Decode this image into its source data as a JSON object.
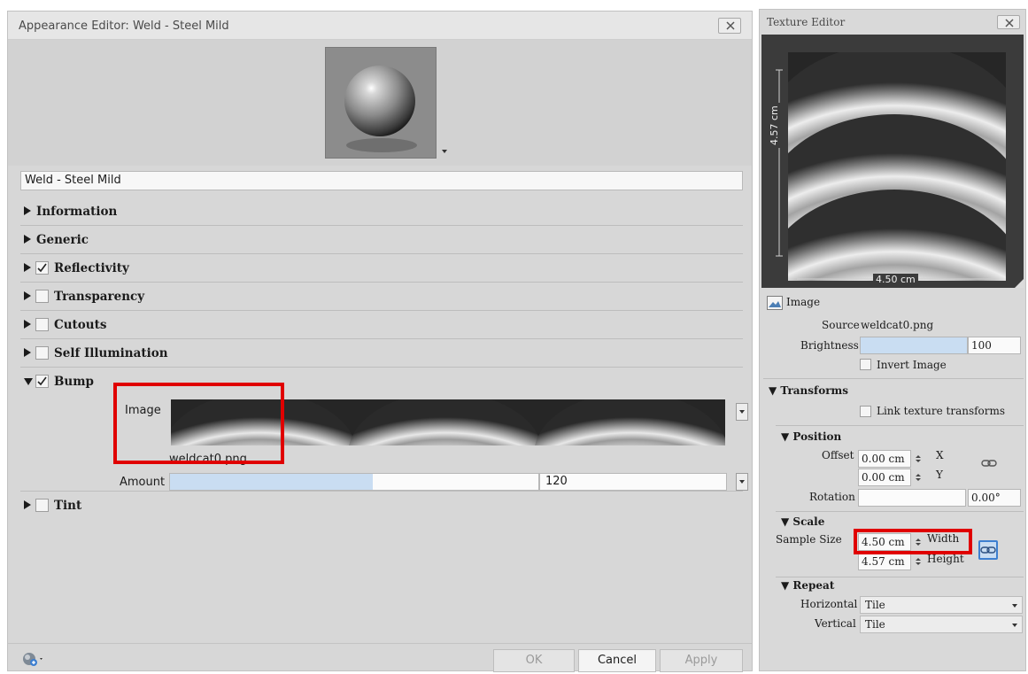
{
  "appearance_editor": {
    "title": "Appearance Editor: Weld - Steel Mild",
    "material_name": "Weld - Steel Mild",
    "sections": {
      "information": "Information",
      "generic": "Generic",
      "reflectivity": "Reflectivity",
      "transparency": "Transparency",
      "cutouts": "Cutouts",
      "self_illumination": "Self Illumination",
      "bump": "Bump",
      "tint": "Tint"
    },
    "bump": {
      "image_label": "Image",
      "image_file": "weldcat0.png",
      "amount_label": "Amount",
      "amount_value": "120",
      "amount_fraction": 0.55
    },
    "buttons": {
      "ok": "OK",
      "cancel": "Cancel",
      "apply": "Apply"
    }
  },
  "texture_editor": {
    "title": "Texture Editor",
    "preview_height_label": "4.57 cm",
    "preview_width_label": "4.50 cm",
    "image_header": "Image",
    "source_label": "Source",
    "source_value": "weldcat0.png",
    "brightness_label": "Brightness",
    "brightness_value": "100",
    "brightness_fraction": 1.0,
    "invert_label": "Invert Image",
    "transforms_header": "Transforms",
    "link_label": "Link texture transforms",
    "position_header": "Position",
    "offset_label": "Offset",
    "offset_x": "0.00 cm",
    "offset_y": "0.00 cm",
    "x_label": "X",
    "y_label": "Y",
    "rotation_label": "Rotation",
    "rotation_value": "0.00°",
    "scale_header": "Scale",
    "sample_size_label": "Sample Size",
    "width_value": "4.50 cm",
    "height_value": "4.57 cm",
    "width_label": "Width",
    "height_label": "Height",
    "repeat_header": "Repeat",
    "horizontal_label": "Horizontal",
    "horizontal_value": "Tile",
    "vertical_label": "Vertical",
    "vertical_value": "Tile"
  },
  "colors": {
    "highlight": "#e00000",
    "slider_fill": "#c9ddf2",
    "link_active": "#3d7fd0"
  }
}
